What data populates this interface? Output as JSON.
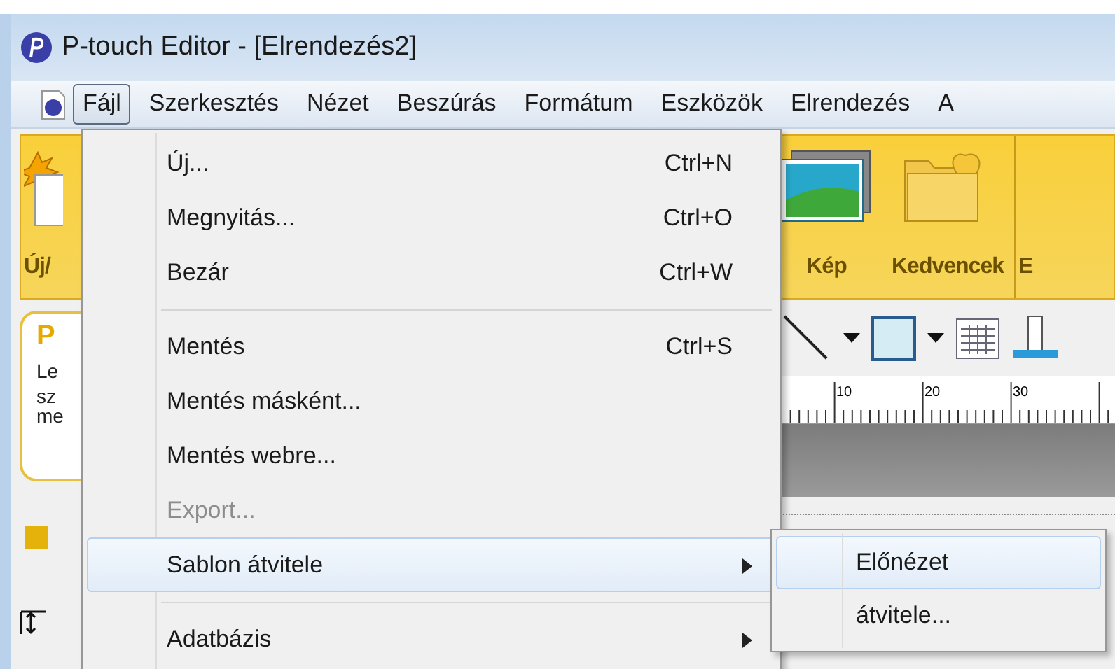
{
  "window": {
    "title": "P-touch Editor - [Elrendezés2]"
  },
  "menu_bar": {
    "items": [
      {
        "label": "Fájl",
        "selected": true
      },
      {
        "label": "Szerkesztés",
        "selected": false
      },
      {
        "label": "Nézet",
        "selected": false
      },
      {
        "label": "Beszúrás",
        "selected": false
      },
      {
        "label": "Formátum",
        "selected": false
      },
      {
        "label": "Eszközök",
        "selected": false
      },
      {
        "label": "Elrendezés",
        "selected": false
      },
      {
        "label": "A",
        "selected": false
      }
    ]
  },
  "ribbon": {
    "buttons": [
      {
        "kind": "new",
        "label": "Új/"
      },
      {
        "kind": "picture",
        "label": "Kép"
      },
      {
        "kind": "favorites",
        "label": "Kedvencek"
      },
      {
        "kind": "cut",
        "label": "E"
      }
    ]
  },
  "side_panel": {
    "title": "P",
    "lines": [
      "Le",
      "sz",
      "me"
    ]
  },
  "ruler": {
    "labels": [
      "10",
      "20",
      "30"
    ]
  },
  "file_menu": {
    "items": [
      {
        "kind": "item",
        "label": "Új...",
        "shortcut": "Ctrl+N",
        "disabled": false,
        "selected": false,
        "submenu": false
      },
      {
        "kind": "item",
        "label": "Megnyitás...",
        "shortcut": "Ctrl+O",
        "disabled": false,
        "selected": false,
        "submenu": false
      },
      {
        "kind": "item",
        "label": "Bezár",
        "shortcut": "Ctrl+W",
        "disabled": false,
        "selected": false,
        "submenu": false
      },
      {
        "kind": "separator"
      },
      {
        "kind": "item",
        "label": "Mentés",
        "shortcut": "Ctrl+S",
        "disabled": false,
        "selected": false,
        "submenu": false
      },
      {
        "kind": "item",
        "label": "Mentés másként...",
        "disabled": false,
        "selected": false,
        "submenu": false
      },
      {
        "kind": "item",
        "label": "Mentés webre...",
        "disabled": false,
        "selected": false,
        "submenu": false
      },
      {
        "kind": "item",
        "label": "Export...",
        "disabled": true,
        "selected": false,
        "submenu": false
      },
      {
        "kind": "item",
        "label": "Sablon átvitele",
        "disabled": false,
        "selected": true,
        "submenu": true
      },
      {
        "kind": "separator"
      },
      {
        "kind": "item",
        "label": "Adatbázis",
        "disabled": false,
        "selected": false,
        "submenu": true
      }
    ]
  },
  "submenu": {
    "items": [
      {
        "label": "Előnézet",
        "selected": true
      },
      {
        "label": "átvitele...",
        "selected": false
      }
    ]
  }
}
